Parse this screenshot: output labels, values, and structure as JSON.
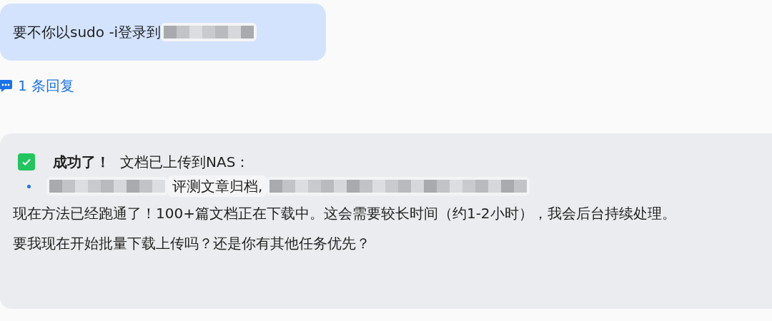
{
  "user_message": {
    "text": "要不你以sudo -i登录到"
  },
  "replies_link": {
    "text": "1 条回复"
  },
  "assistant_message": {
    "status": {
      "checked": true,
      "title": "成功了！",
      "text": "文档已上传到NAS："
    },
    "bullets": [
      {
        "text": "评测文章归档,"
      }
    ],
    "paragraphs": [
      "现在方法已经跑通了！100+篇文档正在下载中。这会需要较长时间（约1-2小时），我会后台持续处理。",
      "要我现在开始批量下载上传吗？还是你有其他任务优先？"
    ]
  }
}
